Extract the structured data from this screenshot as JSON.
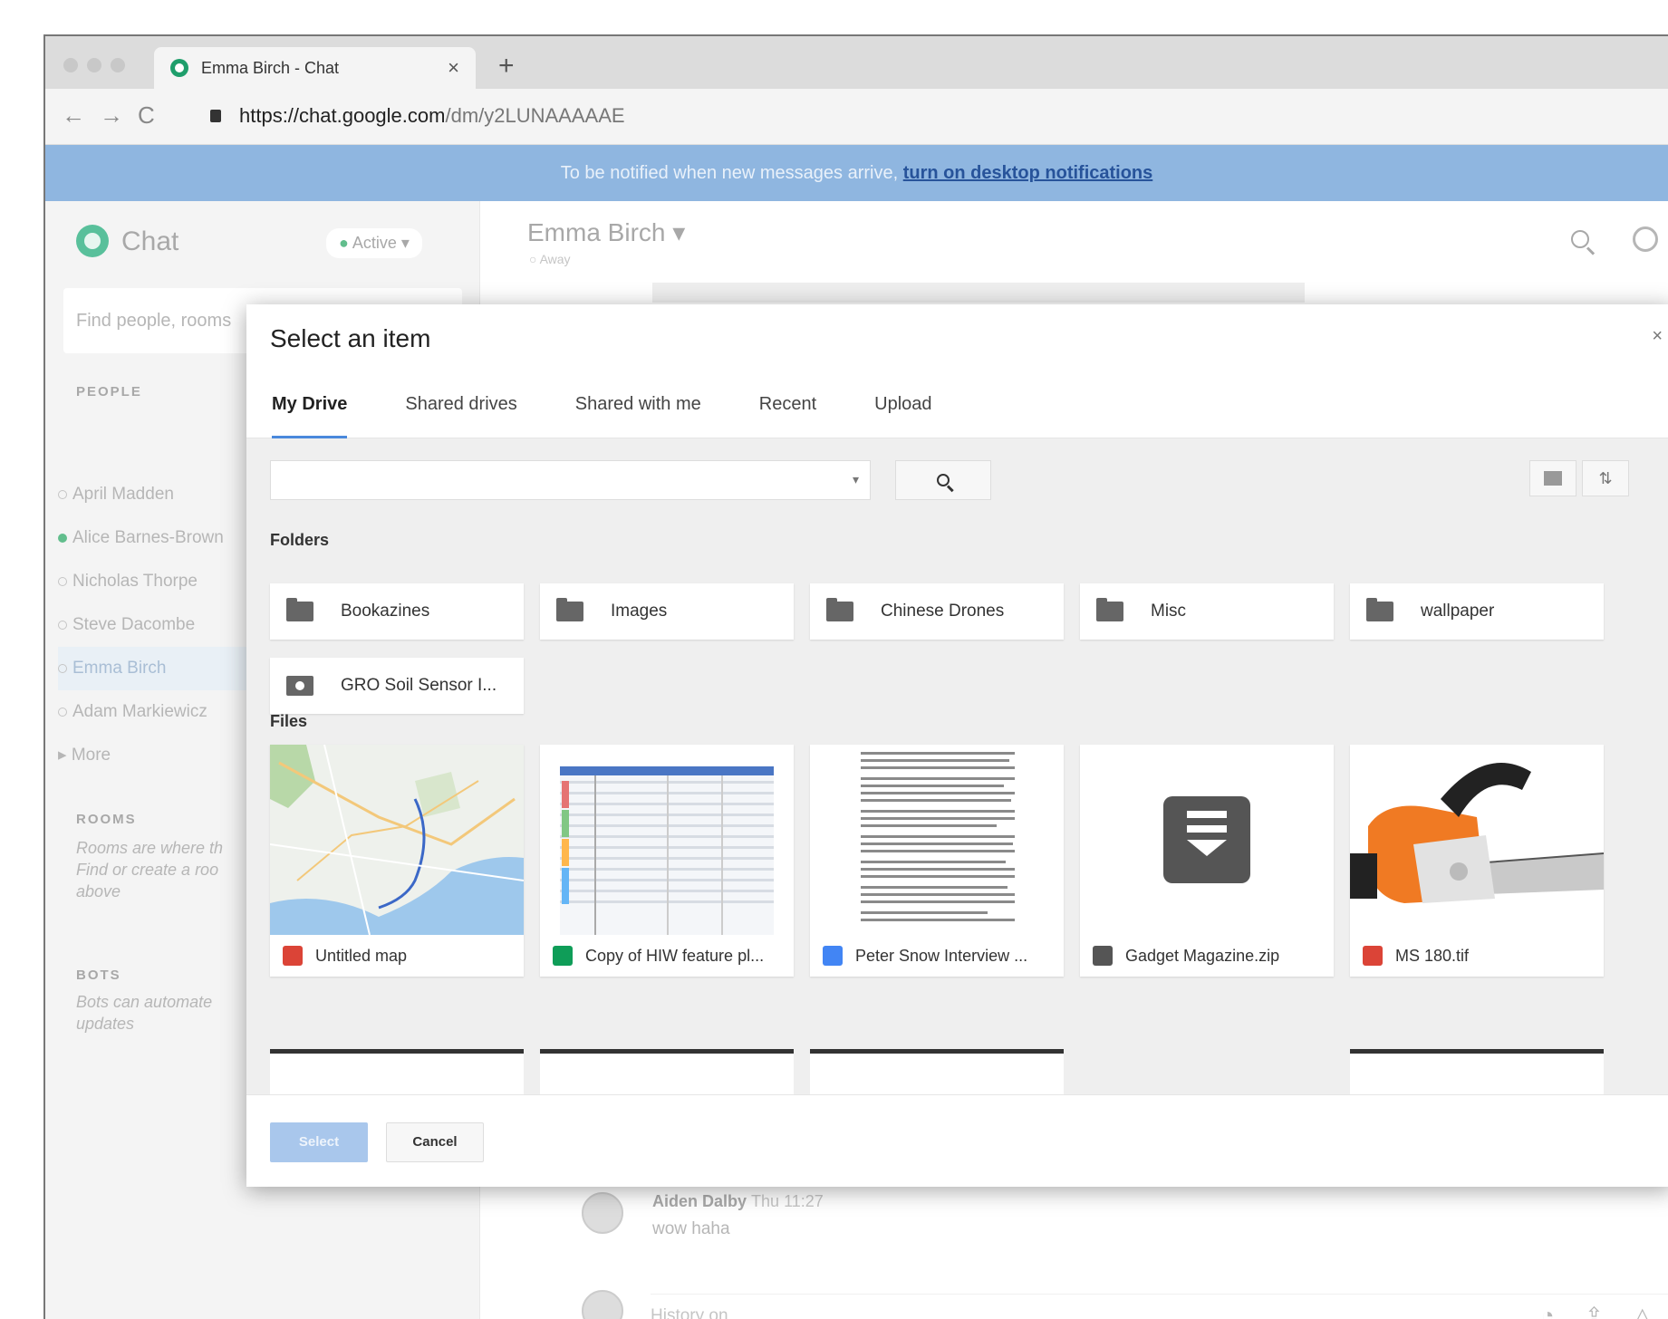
{
  "browser": {
    "tab_title": "Emma Birch - Chat",
    "tab_close": "×",
    "new_tab": "+",
    "back": "←",
    "forward": "→",
    "reload": "C",
    "url_host": "https://chat.google.com",
    "url_path": "/dm/y2LUNAAAAAE"
  },
  "notification": {
    "text": "To be notified when new messages arrive, ",
    "link": "turn on desktop notifications"
  },
  "sidebar": {
    "app_name": "Chat",
    "status": "Active",
    "search_placeholder": "Find people, rooms",
    "people_label": "PEOPLE",
    "people": [
      {
        "name": "April Madden",
        "online": false
      },
      {
        "name": "Alice Barnes-Brown",
        "online": true
      },
      {
        "name": "Nicholas Thorpe",
        "online": false
      },
      {
        "name": "Steve Dacombe",
        "online": false
      },
      {
        "name": "Emma Birch",
        "online": false,
        "selected": true
      },
      {
        "name": "Adam Markiewicz",
        "online": false
      }
    ],
    "more": "More",
    "rooms_label": "ROOMS",
    "rooms_hint": "Rooms are where th Find or create a roo above",
    "bots_label": "BOTS",
    "bots_hint": "Bots can automate updates"
  },
  "conversation": {
    "name": "Emma Birch",
    "status": "Away",
    "message": {
      "author": "Aiden Dalby",
      "time": "Thu 11:27",
      "text": "wow haha"
    },
    "composer": "History on"
  },
  "modal": {
    "title": "Select an item",
    "close": "×",
    "tabs": [
      "My Drive",
      "Shared drives",
      "Shared with me",
      "Recent",
      "Upload"
    ],
    "active_tab": "My Drive",
    "folders_heading": "Folders",
    "folders": [
      {
        "name": "Bookazines",
        "shared": false
      },
      {
        "name": "Images",
        "shared": false
      },
      {
        "name": "Chinese Drones",
        "shared": false
      },
      {
        "name": "Misc",
        "shared": false
      },
      {
        "name": "wallpaper",
        "shared": false
      },
      {
        "name": "GRO Soil Sensor I...",
        "shared": true
      }
    ],
    "files_heading": "Files",
    "files": [
      {
        "name": "Untitled map",
        "type": "map",
        "type_color": "#db4437"
      },
      {
        "name": "Copy of HIW feature pl...",
        "type": "sheet",
        "type_color": "#0f9d58"
      },
      {
        "name": "Peter Snow Interview ...",
        "type": "doc",
        "type_color": "#4285f4"
      },
      {
        "name": "Gadget Magazine.zip",
        "type": "zip",
        "type_color": "#555555"
      },
      {
        "name": "MS 180.tif",
        "type": "image",
        "type_color": "#db4437"
      }
    ],
    "select_button": "Select",
    "cancel_button": "Cancel"
  }
}
